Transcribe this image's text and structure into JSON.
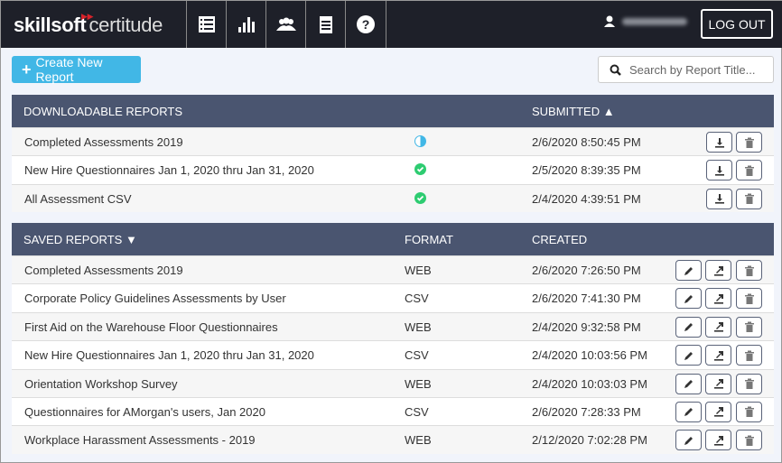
{
  "header": {
    "logo_brand": "skillsoft",
    "logo_product": "certitude",
    "nav_icons": [
      "list-icon",
      "bar-chart-icon",
      "users-icon",
      "notepad-icon",
      "help-icon"
    ],
    "logout": "LOG OUT"
  },
  "toolbar": {
    "create_label": "Create New Report",
    "search_placeholder": "Search by Report Title..."
  },
  "downloadable": {
    "title": "DOWNLOADABLE REPORTS",
    "submitted_label": "SUBMITTED",
    "sort": "ascending",
    "rows": [
      {
        "name": "Completed Assessments 2019",
        "status": "in-progress",
        "submitted": "2/6/2020 8:50:45 PM"
      },
      {
        "name": "New Hire Questionnaires Jan 1, 2020 thru Jan 31, 2020",
        "status": "complete",
        "submitted": "2/5/2020 8:39:35 PM"
      },
      {
        "name": "All Assessment CSV",
        "status": "complete",
        "submitted": "2/4/2020 4:39:51 PM"
      }
    ]
  },
  "saved": {
    "title": "SAVED REPORTS",
    "format_label": "FORMAT",
    "created_label": "CREATED",
    "rows": [
      {
        "name": "Completed Assessments 2019",
        "format": "WEB",
        "created": "2/6/2020 7:26:50 PM"
      },
      {
        "name": "Corporate Policy Guidelines Assessments by User",
        "format": "CSV",
        "created": "2/6/2020 7:41:30 PM"
      },
      {
        "name": "First Aid on the Warehouse Floor Questionnaires",
        "format": "WEB",
        "created": "2/4/2020 9:32:58 PM"
      },
      {
        "name": "New Hire Questionnaires Jan 1, 2020 thru Jan 31, 2020",
        "format": "CSV",
        "created": "2/4/2020 10:03:56 PM"
      },
      {
        "name": "Orientation Workshop Survey",
        "format": "WEB",
        "created": "2/4/2020 10:03:03 PM"
      },
      {
        "name": "Questionnaires for AMorgan's users, Jan 2020",
        "format": "CSV",
        "created": "2/6/2020 7:28:33 PM"
      },
      {
        "name": "Workplace Harassment Assessments - 2019",
        "format": "WEB",
        "created": "2/12/2020 7:02:28 PM"
      }
    ]
  },
  "colors": {
    "topbar": "#1e2029",
    "accent": "#41b7e6",
    "table_header": "#4a5570",
    "complete": "#2ecc71",
    "in_progress": "#41b7e6"
  }
}
